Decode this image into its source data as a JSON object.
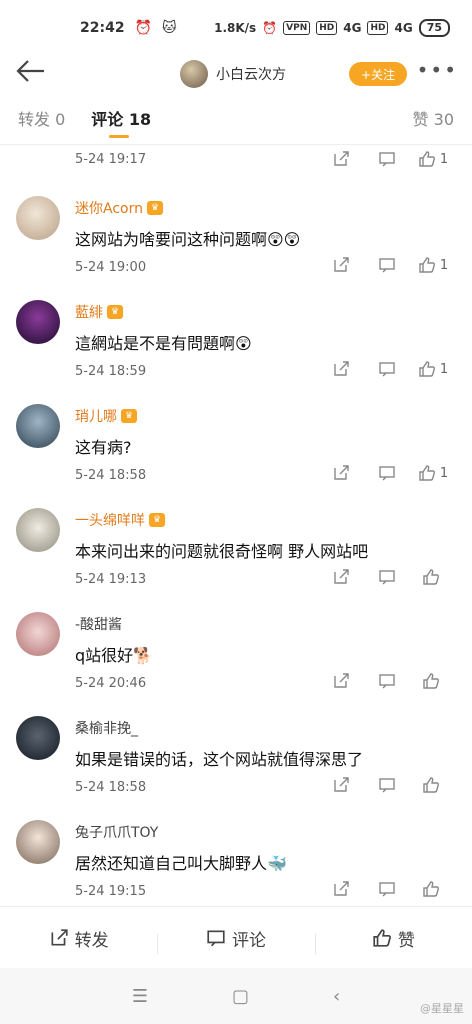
{
  "status": {
    "time": "22:42",
    "speed": "1.8K/s",
    "vpn": "VPN",
    "hd1": "HD",
    "net1": "4G",
    "hd2": "HD",
    "net2": "4G",
    "battery": "75"
  },
  "nav": {
    "username": "小白云次方",
    "follow_label": "+关注",
    "more": "•••"
  },
  "tabs": {
    "repost": "转发 0",
    "comment": "评论 18",
    "like": "赞 30"
  },
  "first_row": {
    "time": "5-24 19:17",
    "likes": "1"
  },
  "comments": [
    {
      "name": "迷你Acorn",
      "text": "这网站为啥要问这种问题啊😲😲",
      "time": "5-24 19:00",
      "likes": "1"
    },
    {
      "name": "藍緋",
      "text": "這網站是不是有問題啊😲",
      "time": "5-24 18:59",
      "likes": "1"
    },
    {
      "name": "琑儿哪",
      "text": "这有病?",
      "time": "5-24 18:58",
      "likes": "1"
    },
    {
      "name": "一头绵咩咩",
      "text": "本来问出来的问题就很奇怪啊 野人网站吧",
      "time": "5-24 19:13",
      "likes": ""
    },
    {
      "name": "-酸甜酱",
      "text": "q站很好🐕",
      "time": "5-24 20:46",
      "likes": ""
    },
    {
      "name": "桑榆非挽_",
      "text": "如果是错误的话，这个网站就值得深思了",
      "time": "5-24 18:58",
      "likes": ""
    },
    {
      "name": "兔子爪爪TOY",
      "text": "居然还知道自己叫大脚野人🐳",
      "time": "5-24 19:15",
      "likes": ""
    }
  ],
  "bottom": {
    "repost": "转发",
    "comment": "评论",
    "like": "赞"
  },
  "watermark": "@星星星"
}
